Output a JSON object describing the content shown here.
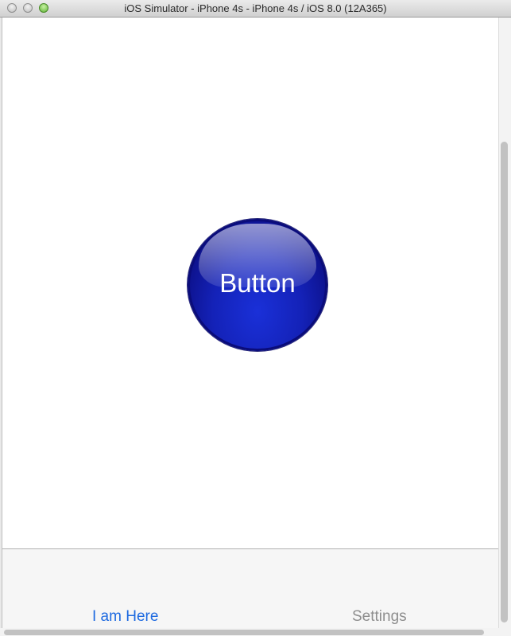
{
  "window": {
    "title": "iOS Simulator - iPhone 4s - iPhone 4s / iOS 8.0 (12A365)"
  },
  "main": {
    "button_label": "Button",
    "button_color": "#1422b8"
  },
  "tabbar": {
    "items": [
      {
        "label": "I am Here",
        "selected": true,
        "color": "#1e6ae0"
      },
      {
        "label": "Settings",
        "selected": false,
        "color": "#8e8e8e"
      }
    ]
  }
}
